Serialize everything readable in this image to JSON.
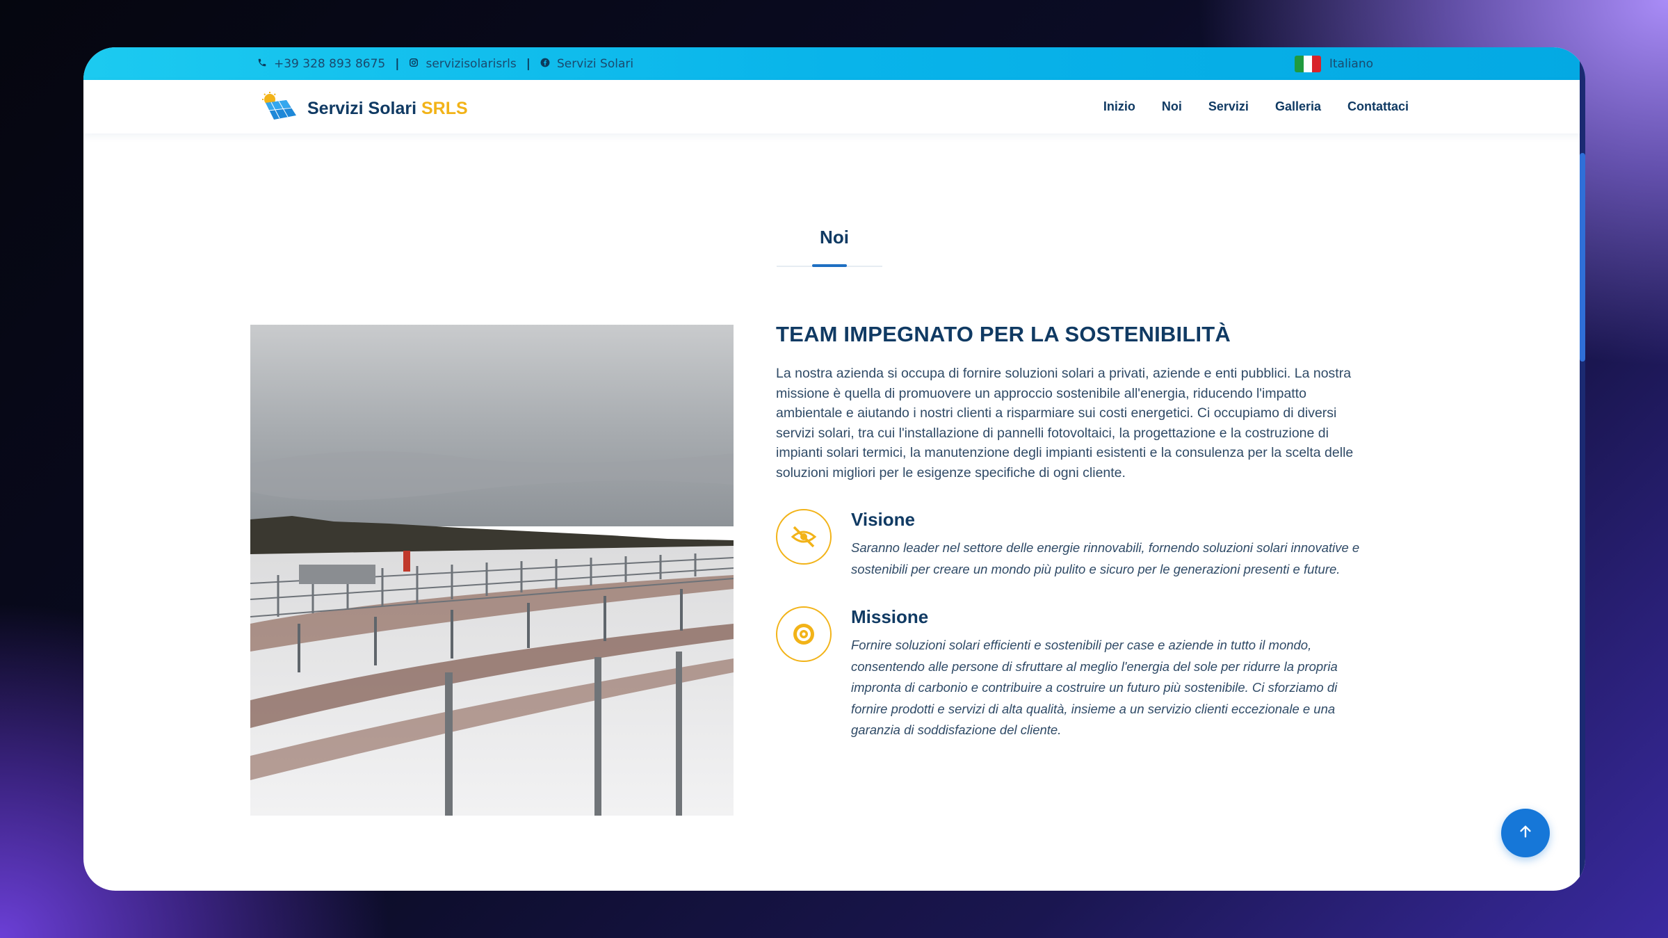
{
  "topbar": {
    "phone": "+39 328 893 8675",
    "instagram": "servizisolarisrls",
    "facebook": "Servizi Solari",
    "language": "Italiano"
  },
  "brand": {
    "name": "Servizi Solari",
    "suffix": "SRLS"
  },
  "nav": {
    "items": [
      "Inizio",
      "Noi",
      "Servizi",
      "Galleria",
      "Contattaci"
    ]
  },
  "section": {
    "title": "Noi"
  },
  "about": {
    "headline": "TEAM IMPEGNATO PER LA SOSTENIBILITÀ",
    "intro": "La nostra azienda si occupa di fornire soluzioni solari a privati, aziende e enti pubblici. La nostra missione è quella di promuovere un approccio sostenibile all'energia, riducendo l'impatto ambientale e aiutando i nostri clienti a risparmiare sui costi energetici. Ci occupiamo di diversi servizi solari, tra cui l'installazione di pannelli fotovoltaici, la progettazione e la costruzione di impianti solari termici, la manutenzione degli impianti esistenti e la consulenza per la scelta delle soluzioni migliori per le esigenze specifiche di ogni cliente.",
    "features": [
      {
        "icon": "eye-slash-icon",
        "title": "Visione",
        "text": "Saranno leader nel settore delle energie rinnovabili, fornendo soluzioni solari innovative e sostenibili per creare un mondo più pulito e sicuro per le generazioni presenti e future."
      },
      {
        "icon": "target-icon",
        "title": "Missione",
        "text": "Fornire soluzioni solari efficienti e sostenibili per case e aziende in tutto il mondo, consentendo alle persone di sfruttare al meglio l'energia del sole per ridurre la propria impronta di carbonio e contribuire a costruire un futuro più sostenibile. Ci sforziamo di fornire prodotti e servizi di alta qualità, insieme a un servizio clienti eccezionale e una garanzia di soddisfazione del cliente."
      }
    ]
  },
  "colors": {
    "primary": "#103a63",
    "accent": "#f2b318",
    "topbar": "#09b4ea",
    "button": "#1677d8"
  }
}
